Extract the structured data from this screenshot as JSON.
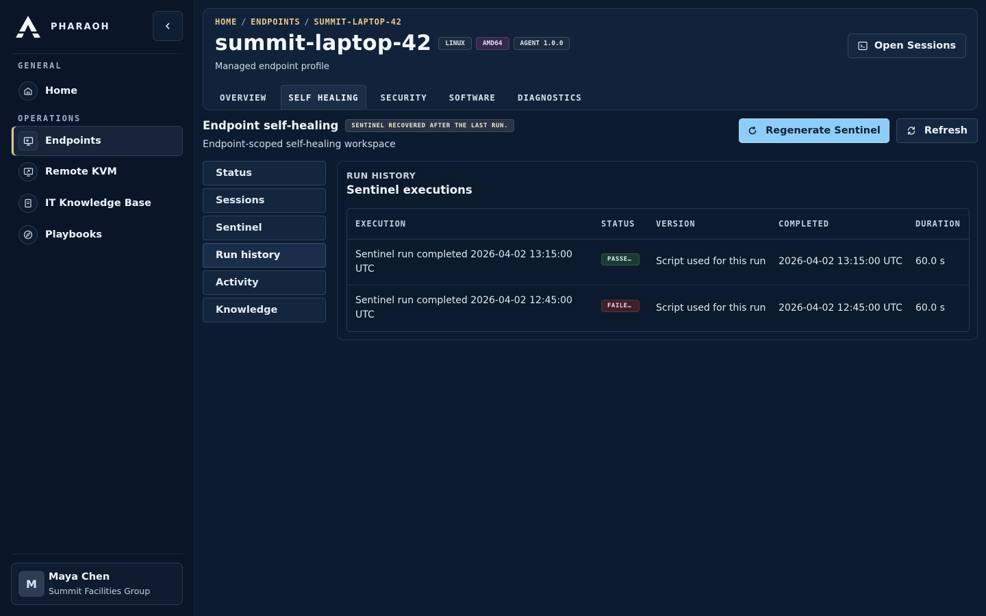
{
  "brand": {
    "name": "PHARAOH"
  },
  "sidebar": {
    "sections": {
      "general": "GENERAL",
      "operations": "OPERATIONS"
    },
    "items": [
      {
        "label": "Home",
        "icon": "home-icon"
      },
      {
        "label": "Endpoints",
        "icon": "monitor-icon",
        "active": true
      },
      {
        "label": "Remote KVM",
        "icon": "remote-screen-icon"
      },
      {
        "label": "IT Knowledge Base",
        "icon": "book-icon"
      },
      {
        "label": "Playbooks",
        "icon": "compass-icon"
      }
    ],
    "user": {
      "initial": "M",
      "name": "Maya Chen",
      "org": "Summit Facilities Group"
    }
  },
  "header": {
    "breadcrumb": [
      "HOME",
      "ENDPOINTS",
      "SUMMIT-LAPTOP-42"
    ],
    "title": "summit-laptop-42",
    "chips": [
      "LINUX",
      "AMD64",
      "AGENT 1.0.0"
    ],
    "subtitle": "Managed endpoint profile",
    "open_sessions_label": "Open Sessions",
    "tabs": [
      "OVERVIEW",
      "SELF HEALING",
      "SECURITY",
      "SOFTWARE",
      "DIAGNOSTICS"
    ],
    "active_tab": "SELF HEALING"
  },
  "section": {
    "title": "Endpoint self-healing",
    "status_chip": "SENTINEL RECOVERED AFTER THE LAST RUN.",
    "subtitle": "Endpoint-scoped self-healing workspace",
    "regenerate_label": "Regenerate Sentinel",
    "refresh_label": "Refresh"
  },
  "subnav": {
    "items": [
      "Status",
      "Sessions",
      "Sentinel",
      "Run history",
      "Activity",
      "Knowledge"
    ],
    "active": "Run history"
  },
  "panel": {
    "eyebrow": "RUN HISTORY",
    "title": "Sentinel executions",
    "columns": [
      "EXECUTION",
      "STATUS",
      "VERSION",
      "COMPLETED",
      "DURATION"
    ],
    "rows": [
      {
        "execution": "Sentinel run completed 2026-04-02 13:15:00 UTC",
        "status": "PASSE…",
        "version": "Script used for this run",
        "completed": "2026-04-02 13:15:00 UTC",
        "duration": "60.0 s"
      },
      {
        "execution": "Sentinel run completed 2026-04-02 12:45:00 UTC",
        "status": "FAILE…",
        "version": "Script used for this run",
        "completed": "2026-04-02 12:45:00 UTC",
        "duration": "60.0 s"
      }
    ]
  },
  "colors": {
    "accent_gold": "#e6c890",
    "primary_button": "#8ecdf7",
    "background": "#0d1b30",
    "pass": "#1c3a35",
    "fail": "#3e1f2b"
  }
}
